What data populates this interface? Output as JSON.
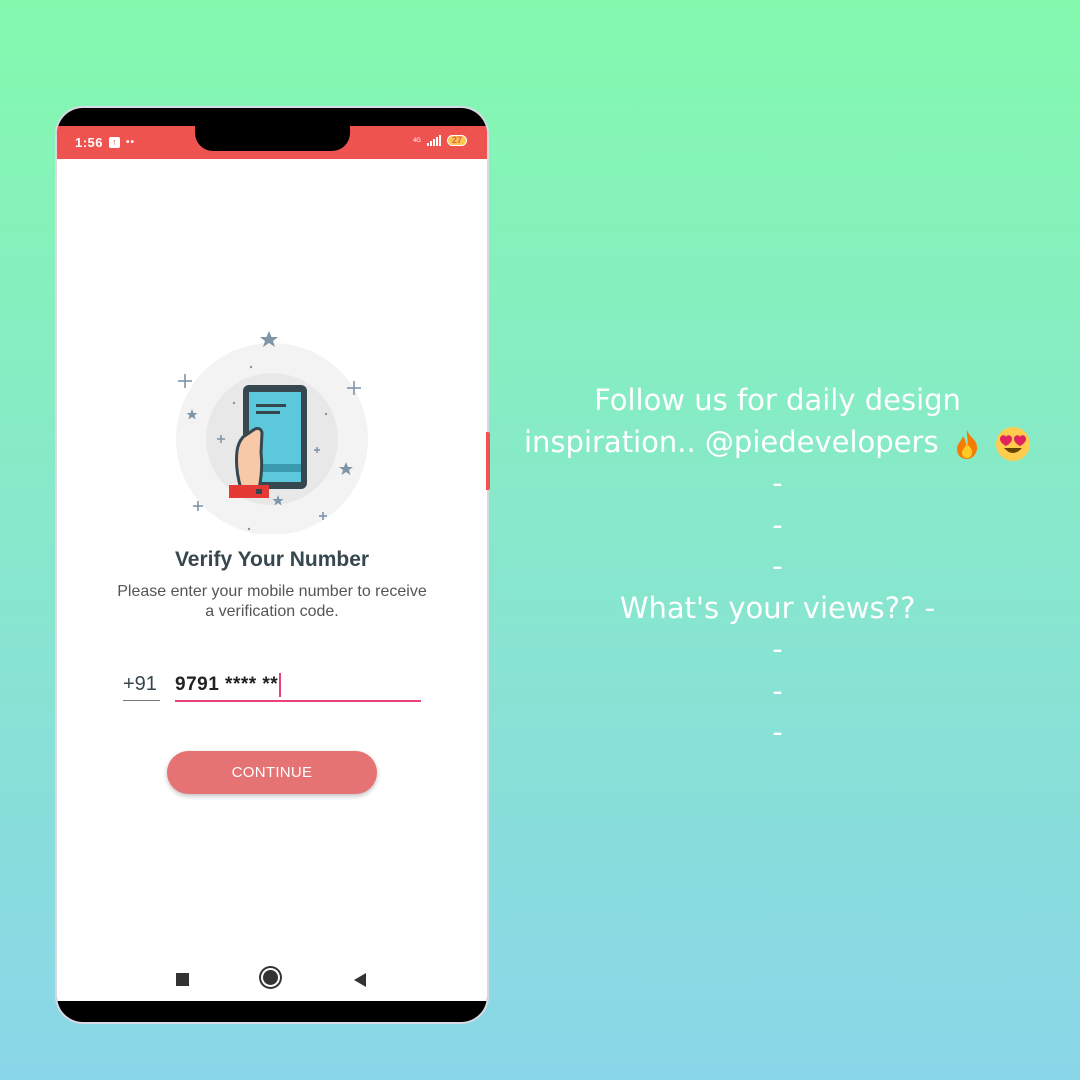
{
  "status_bar": {
    "time": "1:56",
    "network": "4G",
    "battery": "27"
  },
  "verify": {
    "title": "Verify Your Number",
    "subtitle": "Please enter your mobile number to receive a verification code.",
    "country_code": "+91",
    "phone_value": "9791 **** **",
    "continue_label": "CONTINUE"
  },
  "caption": {
    "line1": "Follow us for daily design",
    "line2": "inspiration.. @piedevelopers",
    "dash": "-",
    "question": "What's your views?? -"
  },
  "colors": {
    "accent": "#ef5350",
    "button": "#e57373",
    "input_underline": "#ec407a",
    "background_top": "#84f9ae",
    "background_bottom": "#8ad6e9"
  },
  "icons": [
    "upload-icon",
    "signal-icon",
    "battery-icon",
    "fire-icon",
    "heart-eyes-icon",
    "nav-recents-icon",
    "nav-home-icon",
    "nav-back-icon"
  ]
}
